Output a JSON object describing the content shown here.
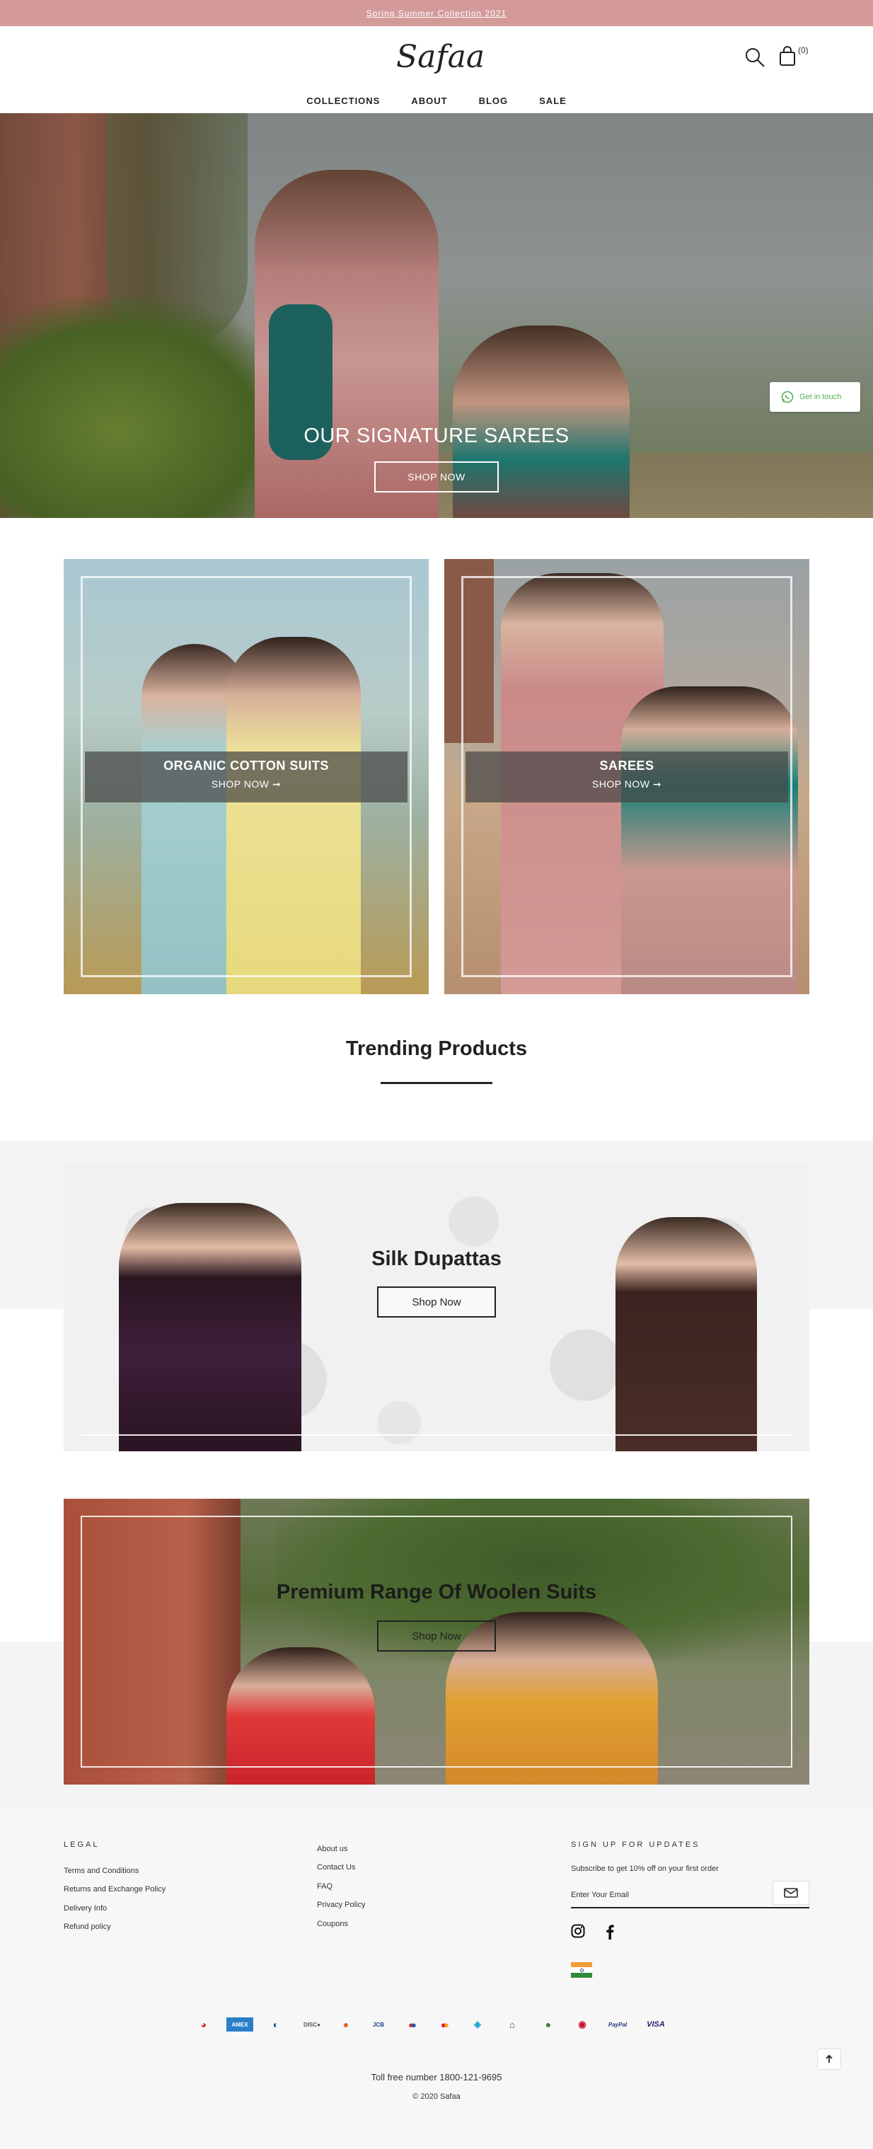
{
  "announcement": {
    "text": "Spring Summer Collection 2021"
  },
  "header": {
    "logo": "Safaa",
    "cart_count": "(0)",
    "nav": [
      "COLLECTIONS",
      "ABOUT",
      "BLOG",
      "SALE"
    ]
  },
  "hero": {
    "title": "OUR SIGNATURE SAREES",
    "button": "SHOP NOW",
    "whatsapp": "Get in touch"
  },
  "collections": [
    {
      "title": "ORGANIC COTTON SUITS",
      "link": "SHOP NOW ➞"
    },
    {
      "title": "SAREES",
      "link": "SHOP NOW ➞"
    }
  ],
  "trending": {
    "title": "Trending Products"
  },
  "banner_dupattas": {
    "title": "Silk Dupattas",
    "button": "Shop Now"
  },
  "banner_woolen": {
    "title": "Premium Range Of Woolen Suits",
    "button": "Shop Now"
  },
  "footer": {
    "legal_heading": "LEGAL",
    "legal_links": [
      "Terms and Conditions",
      "Returns and Exchange Policy",
      "Delivery Info",
      "Refund policy"
    ],
    "info_links": [
      "About us",
      "Contact Us",
      "FAQ",
      "Privacy Policy",
      "Coupons"
    ],
    "signup_heading": "SIGN UP FOR UPDATES",
    "signup_text": "Subscribe to get 10% off on your first order",
    "email_placeholder": "Enter Your Email",
    "payment_methods": [
      "airtel",
      "AMEX",
      "diners",
      "DISCOVER",
      "freecharge",
      "JCB",
      "maestro",
      "mastercard",
      "mobikwik",
      "netbanking",
      "ola",
      "paytm",
      "PayPal",
      "VISA"
    ],
    "toll_free": "Toll free number 1800-121-9695",
    "copyright": "© 2020 Safaa"
  },
  "colors": {
    "announce_bg": "#d49a9a",
    "whatsapp_green": "#4caf50"
  }
}
